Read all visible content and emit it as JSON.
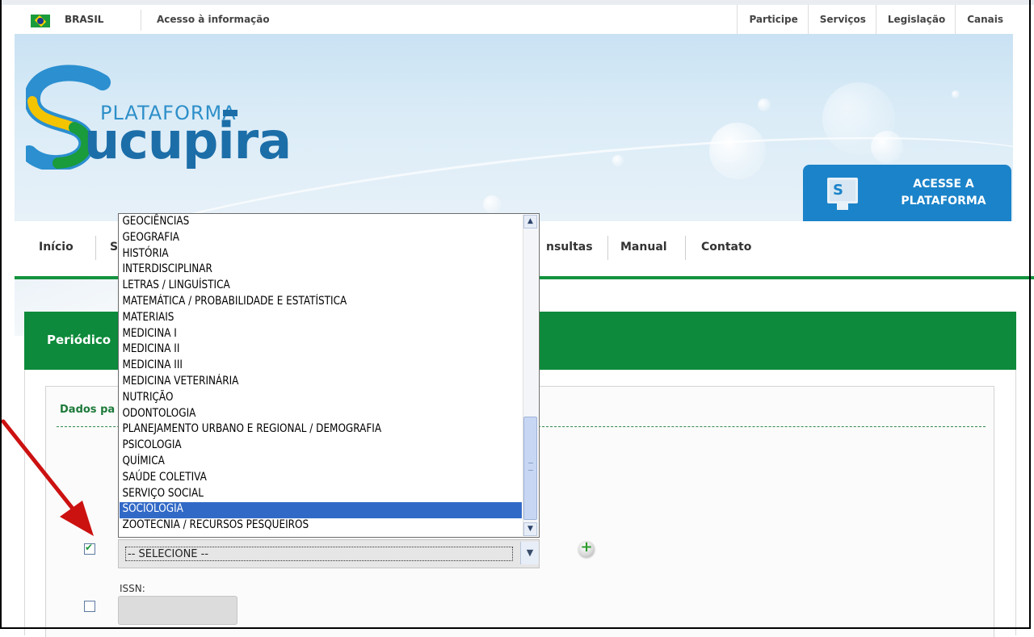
{
  "gov_bar": {
    "country": "BRASIL",
    "acesso": "Acesso à informação",
    "links": [
      "Participe",
      "Serviços",
      "Legislação",
      "Canais"
    ]
  },
  "logo": {
    "small": "PLATAFORMA",
    "big": "ucupira",
    "letter": "S"
  },
  "acesse": {
    "line1": "ACESSE A",
    "line2": "PLATAFORMA"
  },
  "nav": {
    "items": [
      "Início",
      "S",
      "nsultas",
      "Manual",
      "Contato"
    ]
  },
  "panel": {
    "title": "Periódico",
    "section_title": "Dados pa"
  },
  "area_select": {
    "value": "-- SELECIONE --",
    "options": [
      "GEOCIÊNCIAS",
      "GEOGRAFIA",
      "HISTÓRIA",
      "INTERDISCIPLINAR",
      "LETRAS / LINGUÍSTICA",
      "MATEMÁTICA / PROBABILIDADE E ESTATÍSTICA",
      "MATERIAIS",
      "MEDICINA I",
      "MEDICINA II",
      "MEDICINA III",
      "MEDICINA VETERINÁRIA",
      "NUTRIÇÃO",
      "ODONTOLOGIA",
      "PLANEJAMENTO URBANO E REGIONAL / DEMOGRAFIA",
      "PSICOLOGIA",
      "QUÍMICA",
      "SAÚDE COLETIVA",
      "SERVIÇO SOCIAL",
      "SOCIOLOGIA",
      "ZOOTECNIA / RECURSOS PESQUEIROS"
    ],
    "selected": "SOCIOLOGIA"
  },
  "area_checkbox_checked": true,
  "issn": {
    "label": "ISSN:",
    "value": "",
    "checked": false
  },
  "colors": {
    "green": "#0d8a3b",
    "blue": "#1b83c9",
    "selected_option": "#3169c6",
    "arrow": "#cc1111"
  },
  "icons": {
    "add": "plus-circle-icon",
    "flag": "brazil-flag-icon"
  }
}
